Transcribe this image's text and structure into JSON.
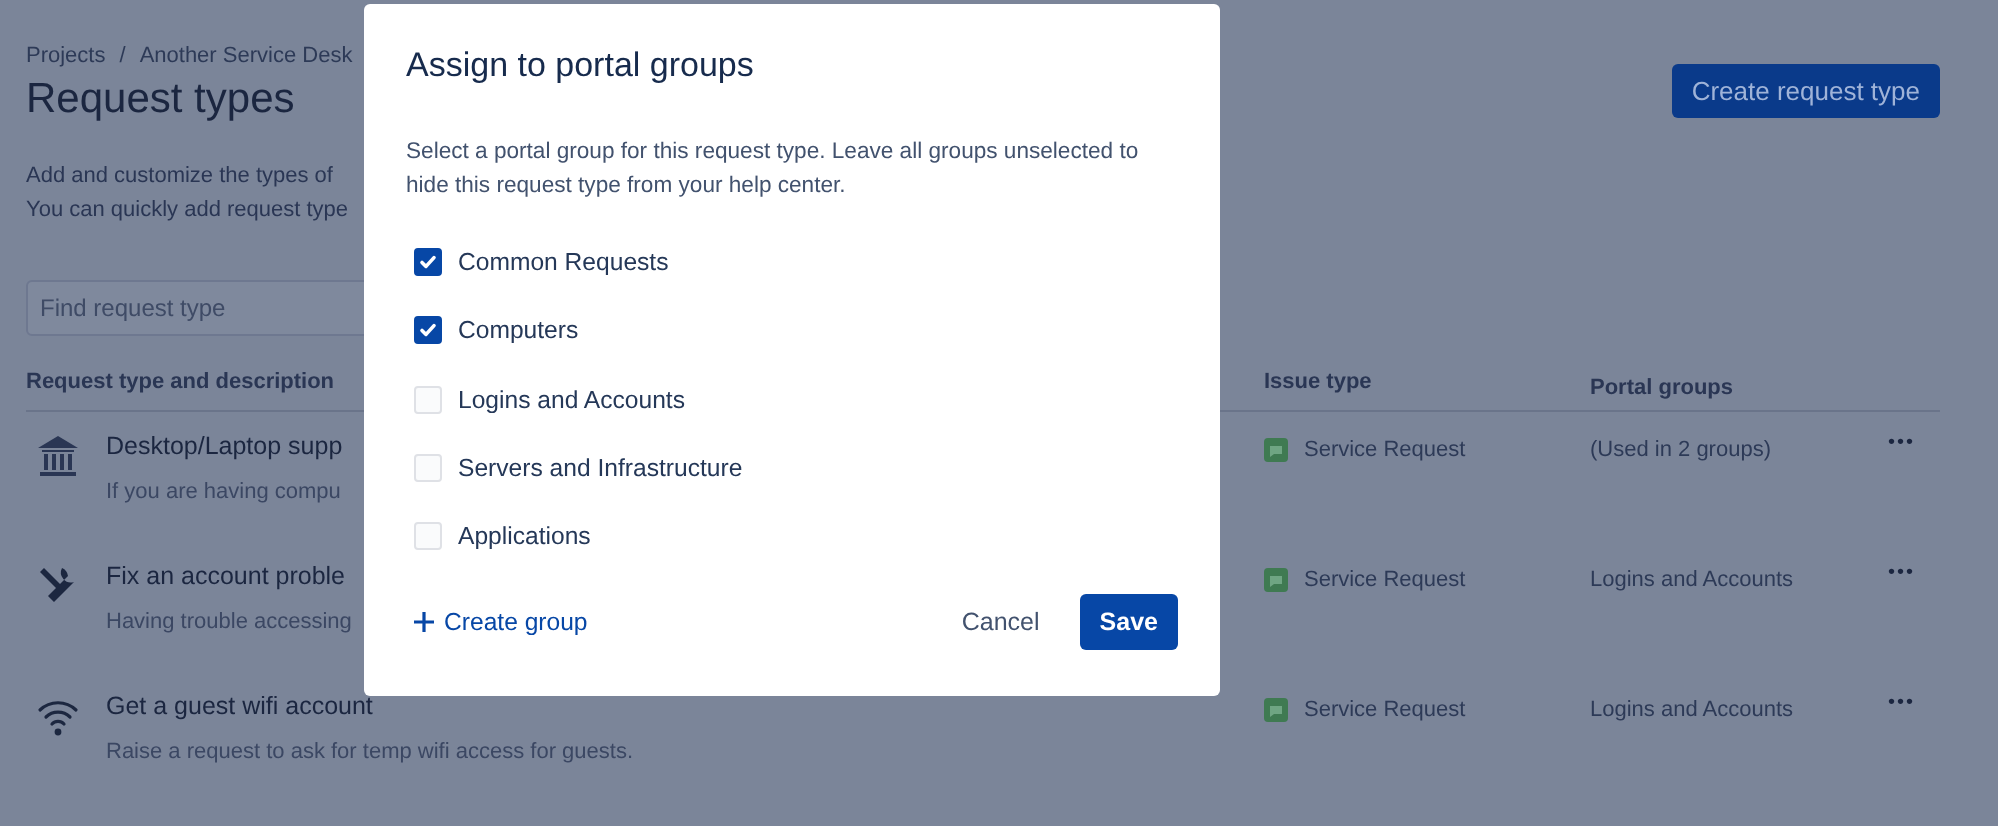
{
  "breadcrumbs": [
    "Projects",
    "Another Service Desk"
  ],
  "breadcrumb_separator": "/",
  "title": "Request types",
  "create_button": "Create request type",
  "description": [
    "Add and customize the types of",
    "You can quickly add request type"
  ],
  "search": {
    "placeholder": "Find request type"
  },
  "table": {
    "columns": [
      "Request type and description",
      "Issue type",
      "Portal groups"
    ],
    "rows": [
      {
        "name": "Desktop/Laptop supp",
        "description": "If you are having compu",
        "issue_type": "Service Request",
        "portal_groups": "(Used in 2 groups)",
        "more": "•••"
      },
      {
        "name": "Fix an account proble",
        "description": "Having trouble accessing",
        "issue_type": "Service Request",
        "portal_groups": "Logins and Accounts",
        "more": "•••"
      },
      {
        "name": "Get a guest wifi account",
        "description": "Raise a request to ask for temp wifi access for guests.",
        "issue_type": "Service Request",
        "portal_groups": "Logins and Accounts",
        "more": "•••"
      }
    ]
  },
  "dialog": {
    "title": "Assign to portal groups",
    "text": "Select a portal group for this request type. Leave all groups unselected to hide this request type from your help center.",
    "groups": [
      {
        "label": "Common Requests",
        "checked": true
      },
      {
        "label": "Computers",
        "checked": true
      },
      {
        "label": "Logins and Accounts",
        "checked": false
      },
      {
        "label": "Servers and Infrastructure",
        "checked": false
      },
      {
        "label": "Applications",
        "checked": false
      }
    ],
    "create_link": "Create group",
    "cancel": "Cancel",
    "save": "Save"
  }
}
